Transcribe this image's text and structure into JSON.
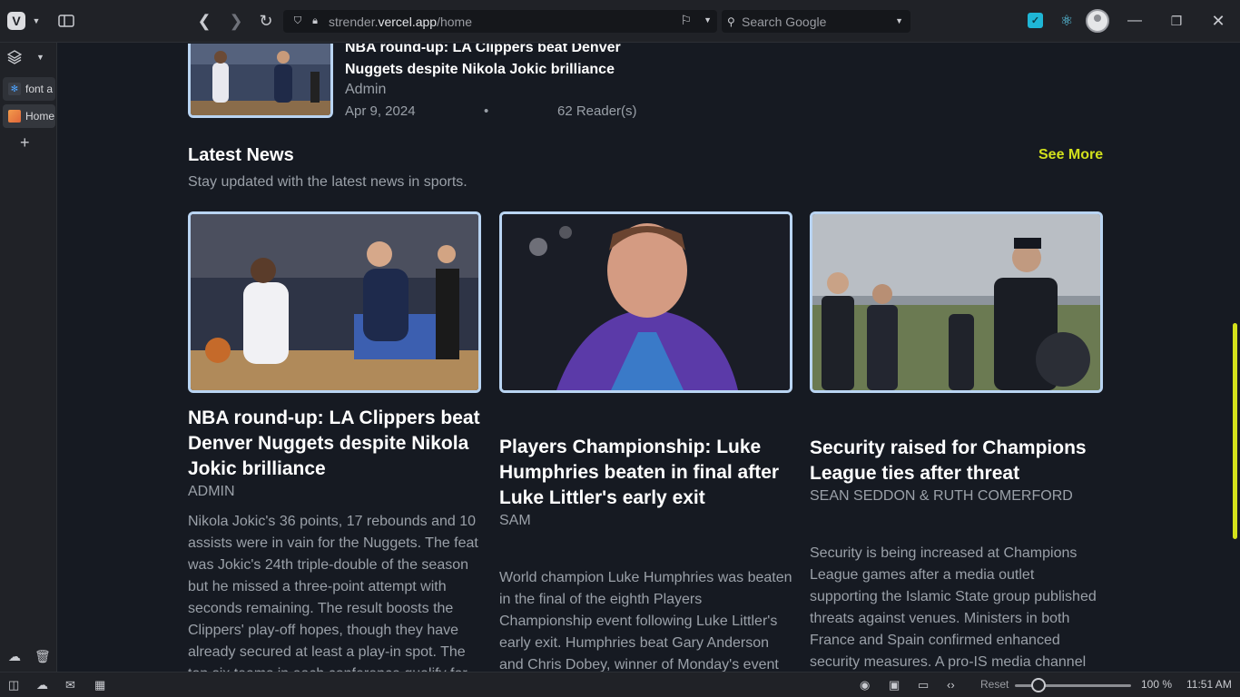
{
  "browser": {
    "url_prefix": "strender.",
    "url_domain": "vercel.app",
    "url_path": "/home",
    "search_placeholder": "Search Google"
  },
  "sidebar": {
    "tabs": [
      {
        "label": "font a"
      },
      {
        "label": "Home"
      }
    ]
  },
  "status": {
    "reset_label": "Reset",
    "zoom": "100 %",
    "time": "11:51 AM"
  },
  "top_article": {
    "title": "NBA round-up: LA Clippers beat Denver Nuggets despite Nikola Jokic brilliance",
    "author": "Admin",
    "date": "Apr 9, 2024",
    "separator": "•",
    "readers": "62 Reader(s)"
  },
  "latest": {
    "title": "Latest News",
    "subtitle": "Stay updated with the latest news in sports.",
    "see_more": "See More",
    "cards": [
      {
        "title": "NBA round-up: LA Clippers beat Denver Nuggets despite Nikola Jokic brilliance",
        "author": "Admin",
        "body": "Nikola Jokic's 36 points, 17 rebounds and 10 assists were in vain for the Nuggets. The feat was Jokic's 24th triple-double of the season but he missed a three-point attempt with seconds remaining. The result boosts the Clippers' play-off hopes, though they have already secured at least a play-in spot. The top six teams in each conference qualify for"
      },
      {
        "title": "Players Championship: Luke Humphries beaten in final after Luke Littler's early exit",
        "author": "Sam",
        "body": "World champion Luke Humphries was beaten in the final of the eighth Players Championship event following Luke Littler's early exit. Humphries beat Gary Anderson and Chris Dobey, winner of Monday's event"
      },
      {
        "title": "Security raised for Champions League ties after threat",
        "author": "Sean Seddon & Ruth Comerford",
        "body": "Security is being increased at Champions League games after a media outlet supporting the Islamic State group published threats against venues. Ministers in both France and Spain confirmed enhanced security measures. A pro-IS media channel"
      }
    ]
  },
  "colors": {
    "background": "#161a22",
    "accent": "#d1e01c",
    "image_border": "#b9d4f2",
    "chrome": "#202227"
  }
}
